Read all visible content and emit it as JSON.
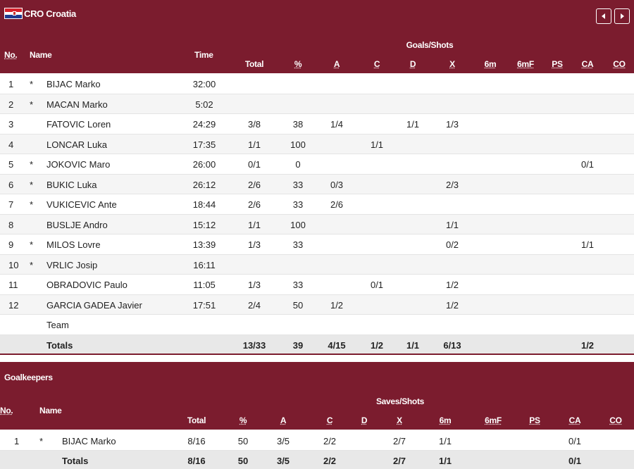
{
  "team": {
    "code_name": "CRO Croatia"
  },
  "nav": {
    "prev_icon": "chevron-left-icon",
    "next_icon": "chevron-right-icon"
  },
  "players_table": {
    "group_header": "Goals/Shots",
    "headers": {
      "no": "No.",
      "name": "Name",
      "time": "Time",
      "total": "Total",
      "pct": "%",
      "a": "A",
      "c": "C",
      "d": "D",
      "x": "X",
      "m6": "6m",
      "m6f": "6mF",
      "ps": "PS",
      "ca": "CA",
      "co": "CO"
    },
    "rows": [
      {
        "no": "1",
        "star": "*",
        "name": "BIJAC Marko",
        "time": "32:00",
        "total": "",
        "pct": "",
        "a": "",
        "c": "",
        "d": "",
        "x": "",
        "ca": ""
      },
      {
        "no": "2",
        "star": "*",
        "name": "MACAN Marko",
        "time": "5:02",
        "total": "",
        "pct": "",
        "a": "",
        "c": "",
        "d": "",
        "x": "",
        "ca": ""
      },
      {
        "no": "3",
        "star": "",
        "name": "FATOVIC Loren",
        "time": "24:29",
        "total": "3/8",
        "pct": "38",
        "a": "1/4",
        "c": "",
        "d": "1/1",
        "x": "1/3",
        "ca": ""
      },
      {
        "no": "4",
        "star": "",
        "name": "LONCAR Luka",
        "time": "17:35",
        "total": "1/1",
        "pct": "100",
        "a": "",
        "c": "1/1",
        "d": "",
        "x": "",
        "ca": ""
      },
      {
        "no": "5",
        "star": "*",
        "name": "JOKOVIC Maro",
        "time": "26:00",
        "total": "0/1",
        "pct": "0",
        "a": "",
        "c": "",
        "d": "",
        "x": "",
        "ca": "0/1"
      },
      {
        "no": "6",
        "star": "*",
        "name": "BUKIC Luka",
        "time": "26:12",
        "total": "2/6",
        "pct": "33",
        "a": "0/3",
        "c": "",
        "d": "",
        "x": "2/3",
        "ca": ""
      },
      {
        "no": "7",
        "star": "*",
        "name": "VUKICEVIC Ante",
        "time": "18:44",
        "total": "2/6",
        "pct": "33",
        "a": "2/6",
        "c": "",
        "d": "",
        "x": "",
        "ca": ""
      },
      {
        "no": "8",
        "star": "",
        "name": "BUSLJE Andro",
        "time": "15:12",
        "total": "1/1",
        "pct": "100",
        "a": "",
        "c": "",
        "d": "",
        "x": "1/1",
        "ca": ""
      },
      {
        "no": "9",
        "star": "*",
        "name": "MILOS Lovre",
        "time": "13:39",
        "total": "1/3",
        "pct": "33",
        "a": "",
        "c": "",
        "d": "",
        "x": "0/2",
        "ca": "1/1"
      },
      {
        "no": "10",
        "star": "*",
        "name": "VRLIC Josip",
        "time": "16:11",
        "total": "",
        "pct": "",
        "a": "",
        "c": "",
        "d": "",
        "x": "",
        "ca": ""
      },
      {
        "no": "11",
        "star": "",
        "name": "OBRADOVIC Paulo",
        "time": "11:05",
        "total": "1/3",
        "pct": "33",
        "a": "",
        "c": "0/1",
        "d": "",
        "x": "1/2",
        "ca": ""
      },
      {
        "no": "12",
        "star": "",
        "name": "GARCIA GADEA Javier",
        "time": "17:51",
        "total": "2/4",
        "pct": "50",
        "a": "1/2",
        "c": "",
        "d": "",
        "x": "1/2",
        "ca": ""
      },
      {
        "no": "",
        "star": "",
        "name": "Team",
        "time": "",
        "total": "",
        "pct": "",
        "a": "",
        "c": "",
        "d": "",
        "x": "",
        "ca": ""
      }
    ],
    "totals": {
      "label": "Totals",
      "total": "13/33",
      "pct": "39",
      "a": "4/15",
      "c": "1/2",
      "d": "1/1",
      "x": "6/13",
      "ca": "1/2"
    }
  },
  "goalkeepers_table": {
    "title": "Goalkeepers",
    "group_header": "Saves/Shots",
    "headers": {
      "no": "No.",
      "name": "Name",
      "total": "Total",
      "pct": "%",
      "a": "A",
      "c": "C",
      "d": "D",
      "x": "X",
      "m6": "6m",
      "m6f": "6mF",
      "ps": "PS",
      "ca": "CA",
      "co": "CO"
    },
    "rows": [
      {
        "no": "1",
        "star": "*",
        "name": "BIJAC Marko",
        "total": "8/16",
        "pct": "50",
        "a": "3/5",
        "c": "2/2",
        "x": "2/7",
        "m6": "1/1",
        "ca": "0/1"
      }
    ],
    "totals": {
      "label": "Totals",
      "total": "8/16",
      "pct": "50",
      "a": "3/5",
      "c": "2/2",
      "x": "2/7",
      "m6": "1/1",
      "ca": "0/1"
    }
  }
}
